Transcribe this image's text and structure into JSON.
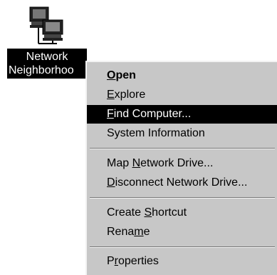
{
  "desktop_icon": {
    "label_line1": "Network",
    "label_line2": "Neighborhoo",
    "icon": "network-computers-icon"
  },
  "context_menu": {
    "items": [
      {
        "label": "Open",
        "mnemonic_pre": "",
        "mnemonic": "O",
        "mnemonic_post": "pen",
        "bold": true
      },
      {
        "label": "Explore",
        "mnemonic_pre": "",
        "mnemonic": "E",
        "mnemonic_post": "xplore"
      },
      {
        "label": "Find Computer...",
        "mnemonic_pre": "",
        "mnemonic": "F",
        "mnemonic_post": "ind Computer...",
        "highlighted": true
      },
      {
        "label": "System Information"
      },
      {
        "label": "Map Network Drive...",
        "mnemonic_pre": "Map ",
        "mnemonic": "N",
        "mnemonic_post": "etwork Drive..."
      },
      {
        "label": "Disconnect Network Drive...",
        "mnemonic_pre": "",
        "mnemonic": "D",
        "mnemonic_post": "isconnect Network Drive..."
      },
      {
        "label": "Create Shortcut",
        "mnemonic_pre": "Create ",
        "mnemonic": "S",
        "mnemonic_post": "hortcut"
      },
      {
        "label": "Rename",
        "mnemonic_pre": "Rena",
        "mnemonic": "m",
        "mnemonic_post": "e"
      },
      {
        "label": "Properties",
        "mnemonic_pre": "P",
        "mnemonic": "r",
        "mnemonic_post": "operties"
      }
    ]
  }
}
